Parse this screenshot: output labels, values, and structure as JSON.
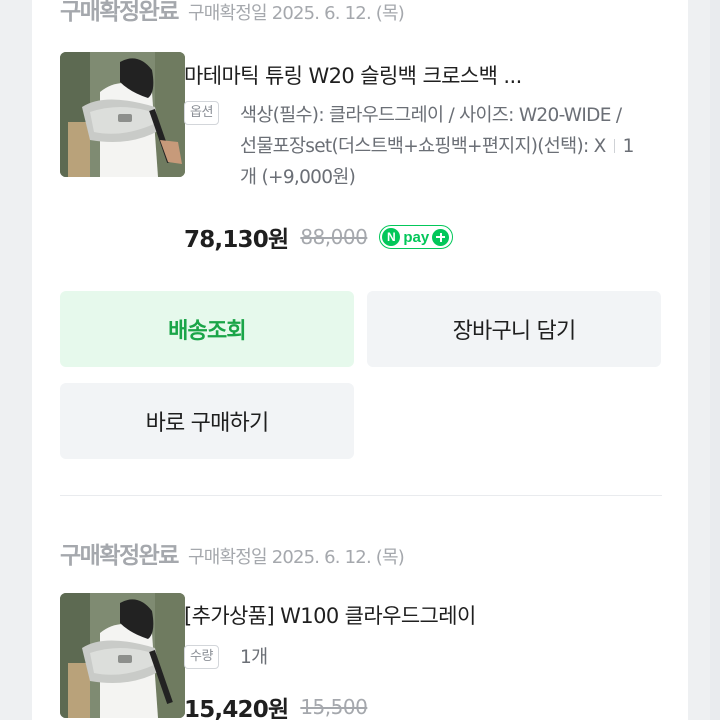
{
  "orders": [
    {
      "status": "구매확정완료",
      "confirm_date": "구매확정일 2025. 6. 12. (목)",
      "product_title": "마테마틱 튜링 W20 슬링백 크로스백 ...",
      "option_badge": "옵션",
      "option_text": "색상(필수): 클라우드그레이 / 사이즈: W20-WIDE / 선물포장set(더스트백+쇼핑백+편지지)(선택): X",
      "option_qty": "1개 (+9,000원)",
      "price": "78,130원",
      "original_price": "88,000",
      "npay_label": "pay",
      "npay_n": "N",
      "buttons": {
        "track": "배송조회",
        "cart": "장바구니 담기",
        "buy_now": "바로 구매하기"
      }
    },
    {
      "status": "구매확정완료",
      "confirm_date": "구매확정일 2025. 6. 12. (목)",
      "product_title": "[추가상품] W100 클라우드그레이",
      "option_badge": "수량",
      "option_text": "1개",
      "price": "15,420원",
      "original_price": "15,500"
    }
  ],
  "colors": {
    "accent_green": "#03c75a",
    "track_button_bg": "#e6f9ec",
    "track_button_text": "#1aa548",
    "muted_text": "#a5a8ad"
  }
}
